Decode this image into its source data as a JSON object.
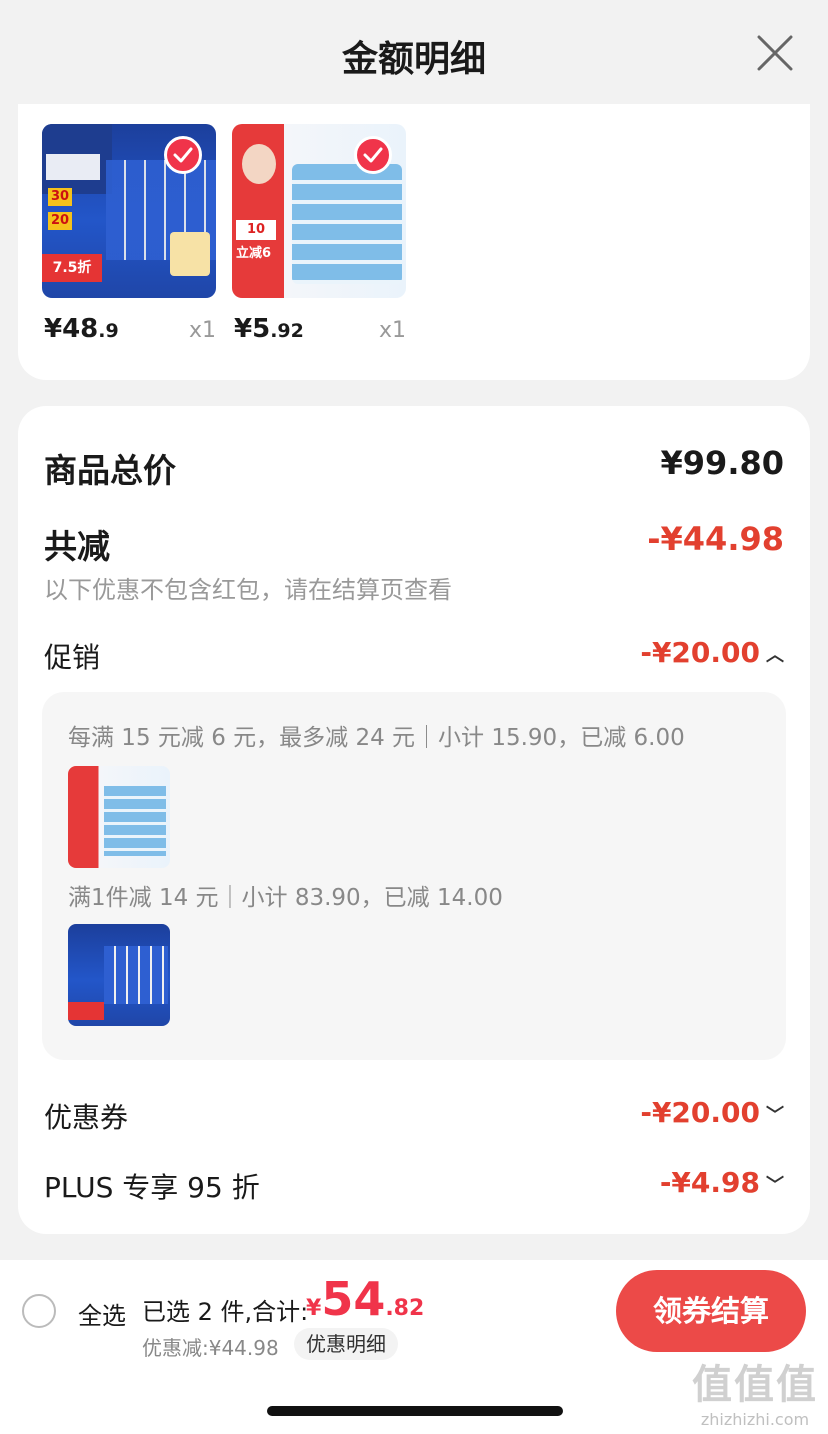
{
  "header": {
    "title": "金额明细"
  },
  "products": [
    {
      "price_int": "¥48",
      "price_dec": ".9",
      "qty": "x1",
      "art": "blue",
      "promo_num": "7.5折",
      "badge1": "30",
      "badge2": "20"
    },
    {
      "price_int": "¥5",
      "price_dec": ".92",
      "qty": "x1",
      "art": "red",
      "promo_text": "立减6",
      "badge1": "10"
    }
  ],
  "summary": {
    "total_label": "商品总价",
    "total_value": "¥99.80",
    "reduce_label": "共减",
    "reduce_value": "-¥44.98",
    "note": "以下优惠不包含红包，请在结算页查看",
    "promo_label": "促销",
    "promo_value": "-¥20.00",
    "promo_chevron": "^",
    "promo_details": [
      {
        "text": "每满 15 元减 6 元，最多减 24 元｜小计 15.90，已减 6.00"
      },
      {
        "text": "满1件减 14 元｜小计 83.90，已减 14.00"
      }
    ],
    "coupon_label": "优惠券",
    "coupon_value": "-¥20.00",
    "coupon_chevron": "v",
    "plus_label": "PLUS 专享 95 折",
    "plus_value": "-¥4.98",
    "plus_chevron": "v"
  },
  "bottom": {
    "select_all": "全选",
    "selected_text": "已选 2 件,合计:",
    "total_cur": "¥",
    "total_int": "54",
    "total_dec": ".82",
    "discount_text": "优惠减:¥44.98",
    "detail_btn": "优惠明细",
    "checkout_btn": "领券结算"
  },
  "watermark": {
    "logo": "值值值",
    "url": "zhizhizhi.com"
  },
  "colors": {
    "accent": "#e2402f",
    "button": "#ec4a48",
    "total": "#f0344a"
  }
}
